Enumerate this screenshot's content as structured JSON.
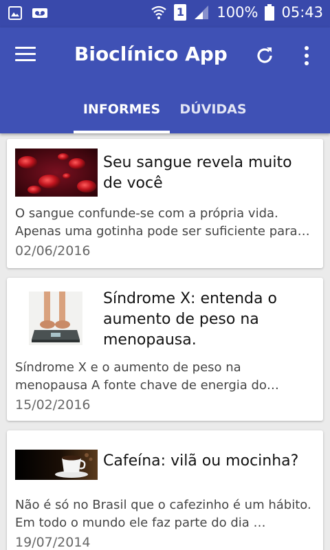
{
  "status_bar": {
    "battery_percent": "100%",
    "time": "05:43",
    "sim_slot": "1",
    "icons": [
      "image-icon",
      "voicemail-icon",
      "wifi-icon",
      "sim-icon",
      "signal-icon",
      "battery-icon"
    ]
  },
  "app_bar": {
    "title": "Bioclínico App",
    "menu_icon": "menu-icon",
    "refresh_icon": "refresh-icon",
    "more_icon": "more-vert-icon",
    "color": "#3f51b5"
  },
  "tabs": [
    {
      "label": "INFORMES",
      "selected": true
    },
    {
      "label": "DÚVIDAS",
      "selected": false
    }
  ],
  "articles": [
    {
      "headline": "Seu sangue revela muito de você",
      "summary": "O sangue confunde-se com a própria vida. Apenas uma gotinha pode ser suficiente para…",
      "date": "02/06/2016",
      "image": "blood-cells-photo"
    },
    {
      "headline": "Síndrome X: entenda o aumento de peso na menopausa.",
      "summary": "Síndrome X e o aumento de peso na menopausa  A fonte chave de energia do…",
      "date": "15/02/2016",
      "image": "scale-feet-photo"
    },
    {
      "headline": "Cafeína: vilã ou mocinha?",
      "summary": "Não é só no Brasil que o cafezinho é um hábito. Em todo o mundo ele faz parte do dia …",
      "date": "19/07/2014",
      "image": "coffee-cup-photo"
    }
  ]
}
